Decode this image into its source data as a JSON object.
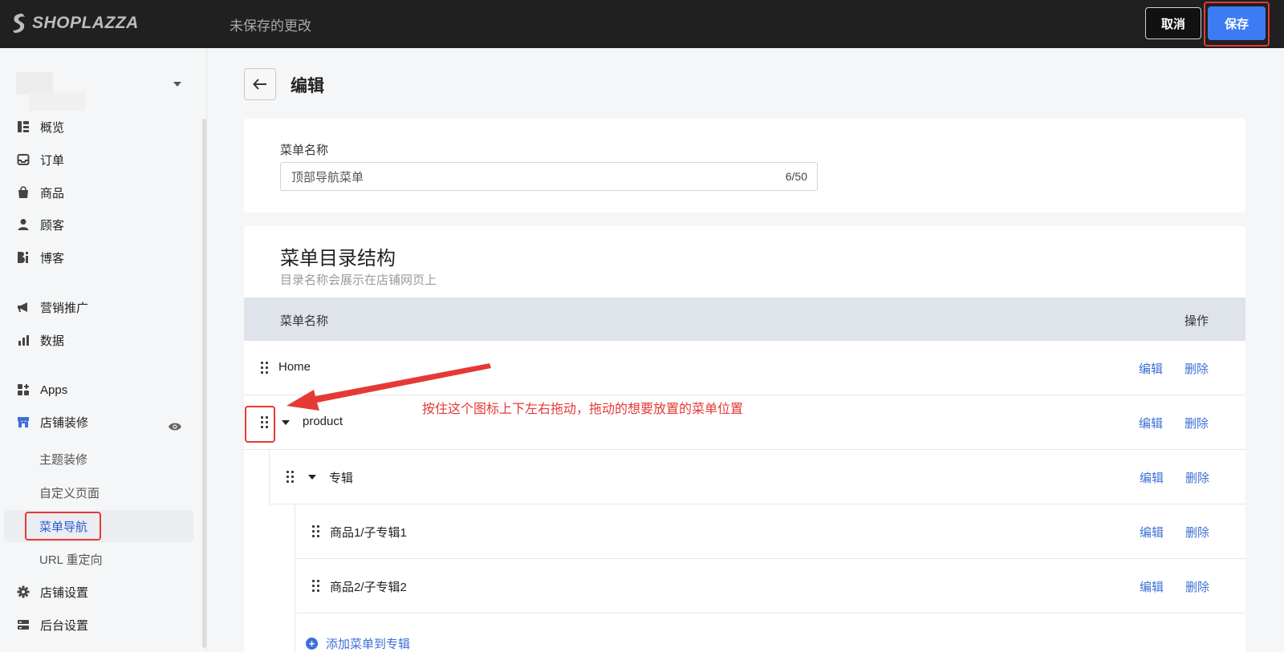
{
  "topbar": {
    "brand": "SHOPLAZZA",
    "status": "未保存的更改",
    "cancel_label": "取消",
    "save_label": "保存",
    "accent_color": "#3d7bf4",
    "background_color": "#202020"
  },
  "sidebar": {
    "items": [
      {
        "label": "概览",
        "icon": "overview-icon"
      },
      {
        "label": "订单",
        "icon": "inbox-icon"
      },
      {
        "label": "商品",
        "icon": "bag-icon"
      },
      {
        "label": "顾客",
        "icon": "user-icon"
      },
      {
        "label": "博客",
        "icon": "blog-icon"
      },
      {
        "label": "营销推广",
        "icon": "megaphone-icon"
      },
      {
        "label": "数据",
        "icon": "bar-chart-icon"
      },
      {
        "label": "Apps",
        "icon": "apps-icon"
      },
      {
        "label": "店铺装修",
        "icon": "storefront-icon"
      },
      {
        "label": "店铺设置",
        "icon": "gear-icon"
      },
      {
        "label": "后台设置",
        "icon": "server-icon"
      }
    ],
    "sub_items": [
      {
        "label": "主题装修"
      },
      {
        "label": "自定义页面"
      },
      {
        "label": "菜单导航"
      },
      {
        "label": "URL 重定向"
      }
    ],
    "active_sub": "菜单导航"
  },
  "page": {
    "title": "编辑"
  },
  "menu_form": {
    "name_label": "菜单名称",
    "name_value": "顶部导航菜单",
    "char_count": "6/50"
  },
  "structure": {
    "title": "菜单目录结构",
    "subtitle": "目录名称会展示在店铺网页上",
    "col_name": "菜单名称",
    "col_ops": "操作",
    "rows": [
      {
        "label": "Home",
        "edit": "编辑",
        "delete": "删除"
      },
      {
        "label": "product",
        "edit": "编辑",
        "delete": "删除"
      },
      {
        "label": "专辑",
        "edit": "编辑",
        "delete": "删除"
      },
      {
        "label": "商品1/子专辑1",
        "edit": "编辑",
        "delete": "删除"
      },
      {
        "label": "商品2/子专辑2",
        "edit": "编辑",
        "delete": "删除"
      }
    ],
    "add_link": "添加菜单到专辑"
  },
  "annotation": {
    "text": "按住这个图标上下左右拖动，拖动的想要放置的菜单位置",
    "color": "#e53935"
  }
}
